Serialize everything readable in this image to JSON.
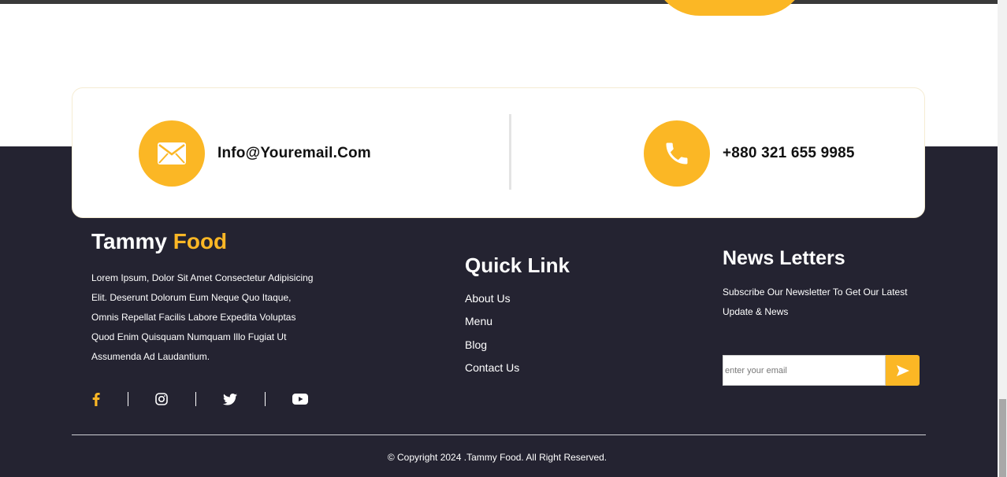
{
  "contact": {
    "email": "Info@Youremail.Com",
    "phone": "+880 321 655 9985"
  },
  "brand": {
    "name_primary": "Tammy",
    "name_accent": "Food",
    "description": "Lorem Ipsum, Dolor Sit Amet Consectetur Adipisicing Elit. Deserunt Dolorum Eum Neque Quo Itaque, Omnis Repellat Facilis Labore Expedita Voluptas Quod Enim Quisquam Numquam Illo Fugiat Ut Assumenda Ad Laudantium."
  },
  "socials": [
    {
      "icon": "facebook-icon",
      "color": "#fbb725"
    },
    {
      "icon": "instagram-icon",
      "color": "#ffffff"
    },
    {
      "icon": "twitter-icon",
      "color": "#ffffff"
    },
    {
      "icon": "youtube-icon",
      "color": "#ffffff"
    }
  ],
  "quick_links": {
    "title": "Quick Link",
    "items": [
      {
        "label": "About Us"
      },
      {
        "label": "Menu"
      },
      {
        "label": "Blog"
      },
      {
        "label": "Contact Us"
      }
    ]
  },
  "newsletter": {
    "title": "News Letters",
    "description": "Subscribe Our Newsletter To Get Our Latest Update & News",
    "placeholder": "enter your email",
    "submit_icon": "send-icon"
  },
  "copyright": "© Copyright 2024 .Tammy Food. All Right Reserved.",
  "colors": {
    "accent": "#fbb725",
    "footer_bg": "#242331"
  }
}
